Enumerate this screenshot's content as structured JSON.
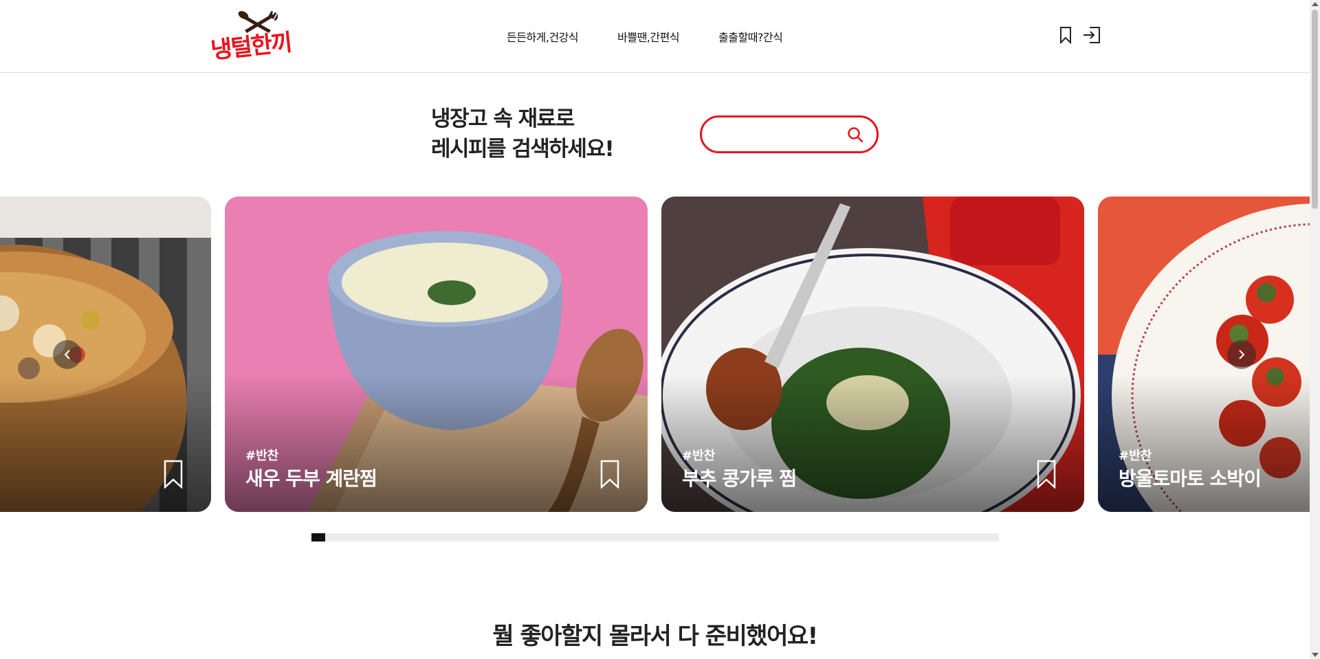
{
  "header": {
    "logo_text": "냉털한끼",
    "nav": [
      {
        "label": "든든하게,건강식"
      },
      {
        "label": "바쁠땐,간편식"
      },
      {
        "label": "출출할때?간식"
      }
    ],
    "icons": [
      "bookmark-icon",
      "login-icon"
    ]
  },
  "search": {
    "title_line1": "냉장고 속 재료로",
    "title_line2": "레시피를 검색하세요!",
    "placeholder": "",
    "value": ""
  },
  "carousel": {
    "cards": [
      {
        "tag": "",
        "title": ""
      },
      {
        "tag": "#반찬",
        "title": "새우 두부 계란찜"
      },
      {
        "tag": "#반찬",
        "title": "부추 콩가루 찜"
      },
      {
        "tag": "#반찬",
        "title": "방울토마토 소박이"
      }
    ],
    "progress": 0.02
  },
  "section": {
    "title": "뭘 좋아할지 몰라서 다 준비했어요!"
  },
  "colors": {
    "accent": "#e5131c",
    "text": "#222222"
  }
}
